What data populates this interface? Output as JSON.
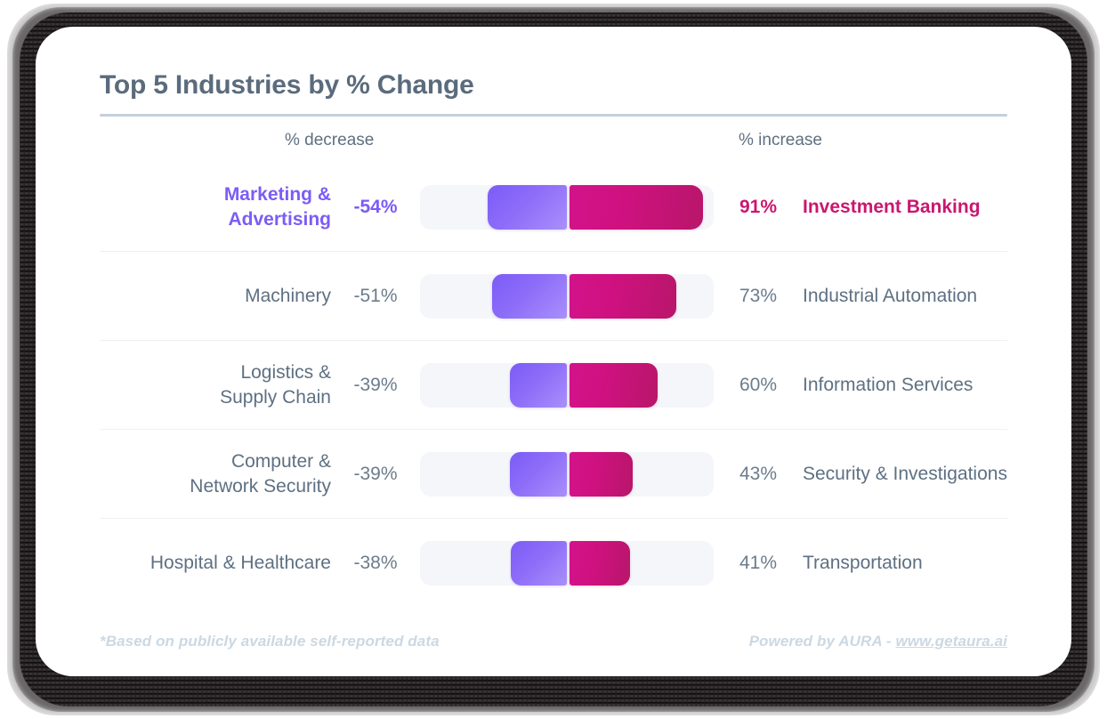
{
  "card": {
    "title": "Top 5 Industries by % Change",
    "accent_purple": "#7c5cf5",
    "accent_pink": "#c9176f",
    "title_color": "#5a6b7c",
    "rule_color": "#c3d0dc",
    "track_color": "#f5f6fa"
  },
  "axis": {
    "decrease_label": "% decrease",
    "increase_label": "% increase"
  },
  "footer": {
    "note": "*Based on publicly available self-reported data",
    "powered_prefix": "Powered by AURA - ",
    "url": "www.getaura.ai"
  },
  "chart_data": {
    "type": "bar",
    "title": "Top 5 Industries by % Change",
    "subtitle": "",
    "xlabel": "",
    "ylabel": "",
    "orientation": "horizontal-bidirectional",
    "grid": false,
    "legend": [
      "% decrease",
      "% increase"
    ],
    "legend_position": "top",
    "axis_center_percent": 50,
    "scale_max_percent": 100,
    "annotations": [
      "*Based on publicly available self-reported data",
      "Powered by AURA - www.getaura.ai"
    ],
    "rows": [
      {
        "decrease_industry": "Marketing &\nAdvertising",
        "decrease_value_label": "-54%",
        "decrease_value": -54,
        "increase_value_label": "91%",
        "increase_value": 91,
        "increase_industry": "Investment Banking",
        "highlighted": true
      },
      {
        "decrease_industry": "Machinery",
        "decrease_value_label": "-51%",
        "decrease_value": -51,
        "increase_value_label": "73%",
        "increase_value": 73,
        "increase_industry": "Industrial Automation",
        "highlighted": false
      },
      {
        "decrease_industry": "Logistics &\nSupply Chain",
        "decrease_value_label": "-39%",
        "decrease_value": -39,
        "increase_value_label": "60%",
        "increase_value": 60,
        "increase_industry": "Information Services",
        "highlighted": false
      },
      {
        "decrease_industry": "Computer &\nNetwork Security",
        "decrease_value_label": "-39%",
        "decrease_value": -39,
        "increase_value_label": "43%",
        "increase_value": 43,
        "increase_industry": "Security & Investigations",
        "highlighted": false
      },
      {
        "decrease_industry": "Hospital & Healthcare",
        "decrease_value_label": "-38%",
        "decrease_value": -38,
        "increase_value_label": "41%",
        "increase_value": 41,
        "increase_industry": "Transportation",
        "highlighted": false
      }
    ]
  }
}
